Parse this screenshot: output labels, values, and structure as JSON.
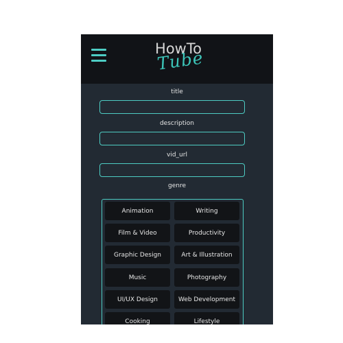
{
  "header": {
    "logo_top": "HowTo",
    "logo_bottom": "Tube"
  },
  "form": {
    "title_label": "title",
    "description_label": "description",
    "vid_url_label": "vid_url",
    "genre_label": "genre",
    "title_value": "",
    "description_value": "",
    "vid_url_value": ""
  },
  "genres": [
    "Animation",
    "Writing",
    "Film & Video",
    "Productivity",
    "Graphic Design",
    "Art & Illustration",
    "Music",
    "Photography",
    "UI/UX Design",
    "Web Development",
    "Cooking",
    "Lifestyle"
  ],
  "colors": {
    "accent": "#4ecdc4",
    "panel": "#222a33",
    "header": "#111317",
    "button": "#121417"
  },
  "icons": {
    "menu": "hamburger-menu-icon"
  }
}
